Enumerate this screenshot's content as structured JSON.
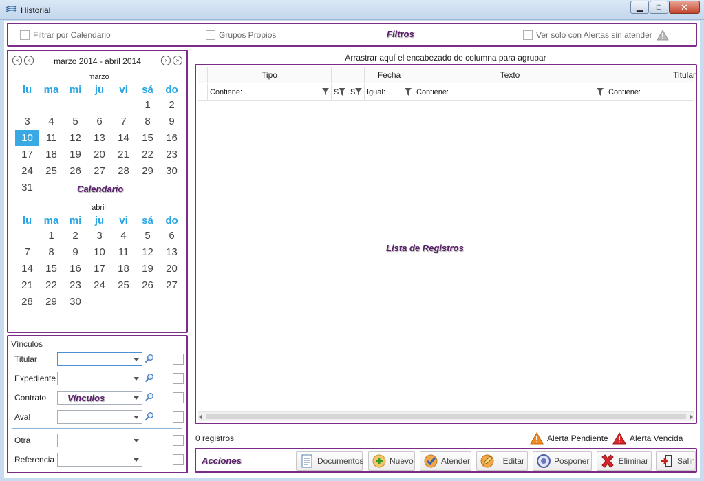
{
  "window": {
    "title": "Historial",
    "minimize_glyph": "▁",
    "maximize_glyph": "□",
    "close_glyph": "✕"
  },
  "filters": {
    "section_label": "Filtros",
    "filter_calendar": "Filtrar por Calendario",
    "own_groups": "Grupos Propios",
    "unattended_alerts": "Ver solo con Alertas sin atender"
  },
  "calendar": {
    "section_label": "Calendario",
    "range": "marzo 2014 - abril 2014",
    "nav_first": "«",
    "nav_prev": "‹",
    "nav_next": "›",
    "nav_last": "»",
    "weekdays": [
      "lu",
      "ma",
      "mi",
      "ju",
      "vi",
      "sá",
      "do"
    ],
    "selected_day": "10",
    "months": [
      {
        "name": "marzo",
        "weeks": [
          [
            "",
            "",
            "",
            "",
            "",
            "1",
            "2"
          ],
          [
            "3",
            "4",
            "5",
            "6",
            "7",
            "8",
            "9"
          ],
          [
            "10",
            "11",
            "12",
            "13",
            "14",
            "15",
            "16"
          ],
          [
            "17",
            "18",
            "19",
            "20",
            "21",
            "22",
            "23"
          ],
          [
            "24",
            "25",
            "26",
            "27",
            "28",
            "29",
            "30"
          ],
          [
            "31",
            "",
            "",
            "",
            "",
            "",
            ""
          ]
        ]
      },
      {
        "name": "abril",
        "weeks": [
          [
            "",
            "1",
            "2",
            "3",
            "4",
            "5",
            "6"
          ],
          [
            "7",
            "8",
            "9",
            "10",
            "11",
            "12",
            "13"
          ],
          [
            "14",
            "15",
            "16",
            "17",
            "18",
            "19",
            "20"
          ],
          [
            "21",
            "22",
            "23",
            "24",
            "25",
            "26",
            "27"
          ],
          [
            "28",
            "29",
            "30",
            "",
            "",
            "",
            ""
          ]
        ]
      }
    ]
  },
  "links": {
    "title": "Vínculos",
    "section_label": "Vínculos",
    "rows": [
      {
        "label": "Titular",
        "value": ""
      },
      {
        "label": "Expediente",
        "value": ""
      },
      {
        "label": "Contrato",
        "value": ""
      },
      {
        "label": "Aval",
        "value": ""
      },
      {
        "label": "Otra",
        "value": ""
      },
      {
        "label": "Referencia",
        "value": ""
      }
    ]
  },
  "list": {
    "section_label": "Lista de Registros",
    "group_hint": "Arrastrar aquí el encabezado de columna para agrupar",
    "columns": [
      {
        "header": "Tipo",
        "filter": "Contiene:"
      },
      {
        "header": "",
        "filter": "S"
      },
      {
        "header": "",
        "filter": "S"
      },
      {
        "header": "Fecha",
        "filter": "Igual:"
      },
      {
        "header": "Texto",
        "filter": "Contiene:"
      },
      {
        "header": "Titular",
        "filter": "Contiene:"
      }
    ],
    "count": "0 registros"
  },
  "legend": {
    "pending": "Alerta Pendiente",
    "expired": "Alerta Vencida"
  },
  "actions": {
    "section_label": "Acciones",
    "buttons": [
      "Documentos",
      "Nuevo",
      "Atender",
      "Editar",
      "Posponer",
      "Eliminar",
      "Salir"
    ]
  },
  "colors": {
    "accent_frame": "#7a2c86",
    "calendar_weekday": "#2aa6e4",
    "selected_day": "#39a9e4",
    "alert_pending": "#f08a1c",
    "alert_expired": "#d92b2b"
  }
}
